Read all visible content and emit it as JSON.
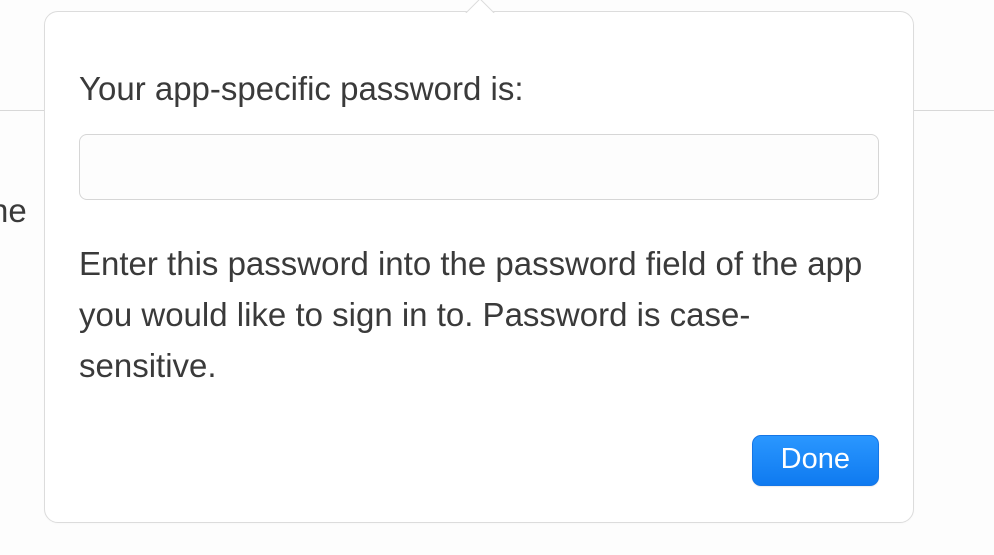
{
  "background": {
    "partial_text": "he"
  },
  "popover": {
    "title": "Your app-specific password is:",
    "password_value": "",
    "instruction": "Enter this password into the password field of the app you would like to sign in to. Password is case-sensitive.",
    "done_label": "Done"
  }
}
